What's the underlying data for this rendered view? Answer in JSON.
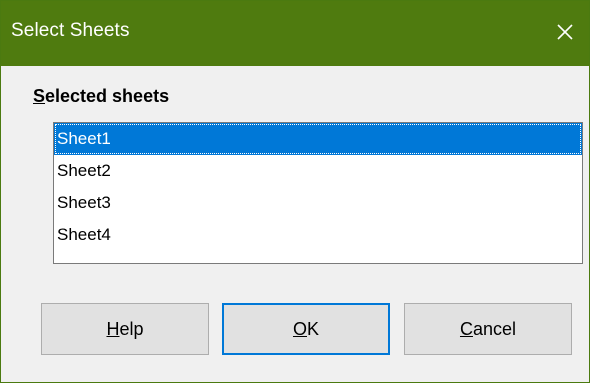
{
  "window": {
    "title": "Select Sheets"
  },
  "section": {
    "label_mnemonic": "S",
    "label_rest": "elected sheets"
  },
  "sheets": {
    "items": [
      {
        "label": "Sheet1",
        "selected": true
      },
      {
        "label": "Sheet2",
        "selected": false
      },
      {
        "label": "Sheet3",
        "selected": false
      },
      {
        "label": "Sheet4",
        "selected": false
      }
    ]
  },
  "buttons": {
    "help_mnemonic": "H",
    "help_rest": "elp",
    "ok_mnemonic": "O",
    "ok_rest": "K",
    "cancel_mnemonic": "C",
    "cancel_rest": "ancel"
  },
  "icons": {
    "close": "close-icon"
  },
  "colors": {
    "titlebar": "#4f7b0f",
    "selection": "#0078d7",
    "dialog_bg": "#f0f0f0"
  }
}
